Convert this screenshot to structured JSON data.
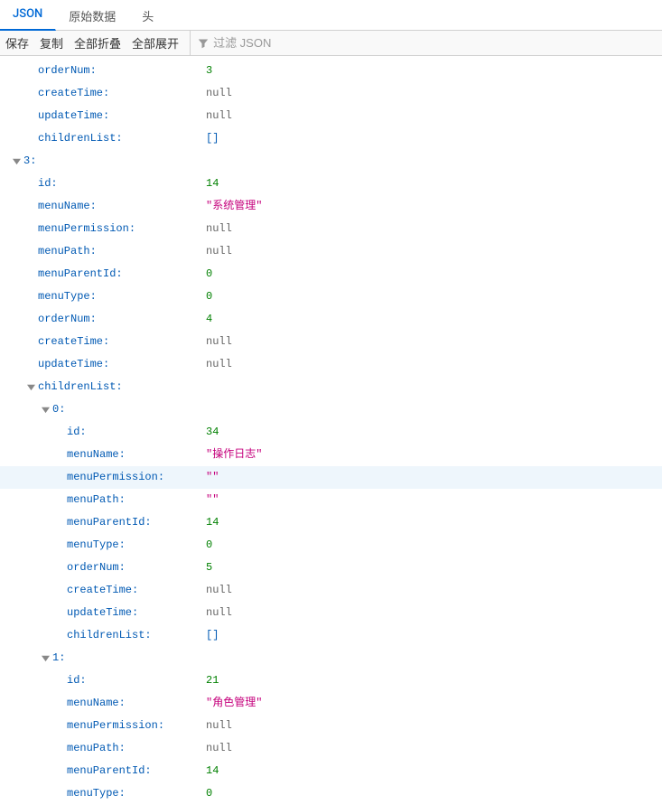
{
  "tabs": {
    "json": "JSON",
    "raw": "原始数据",
    "headers": "头"
  },
  "toolbar": {
    "save": "保存",
    "copy": "复制",
    "collapseAll": "全部折叠",
    "expandAll": "全部展开",
    "filterPlaceholder": "过滤 JSON"
  },
  "tree": {
    "partialTop": {
      "orderNum": {
        "key": "orderNum",
        "value": "3",
        "type": "num"
      },
      "createTime": {
        "key": "createTime",
        "value": "null",
        "type": "null"
      },
      "updateTime": {
        "key": "updateTime",
        "value": "null",
        "type": "null"
      },
      "childrenList": {
        "key": "childrenList",
        "value": "[]",
        "type": "bracket"
      }
    },
    "node3": {
      "index": "3",
      "id": {
        "key": "id",
        "value": "14",
        "type": "num"
      },
      "menuName": {
        "key": "menuName",
        "value": "\"系统管理\"",
        "type": "str"
      },
      "menuPermission": {
        "key": "menuPermission",
        "value": "null",
        "type": "null"
      },
      "menuPath": {
        "key": "menuPath",
        "value": "null",
        "type": "null"
      },
      "menuParentId": {
        "key": "menuParentId",
        "value": "0",
        "type": "num"
      },
      "menuType": {
        "key": "menuType",
        "value": "0",
        "type": "num"
      },
      "orderNum": {
        "key": "orderNum",
        "value": "4",
        "type": "num"
      },
      "createTime": {
        "key": "createTime",
        "value": "null",
        "type": "null"
      },
      "updateTime": {
        "key": "updateTime",
        "value": "null",
        "type": "null"
      },
      "childrenListKey": "childrenList",
      "child0": {
        "index": "0",
        "id": {
          "key": "id",
          "value": "34",
          "type": "num"
        },
        "menuName": {
          "key": "menuName",
          "value": "\"操作日志\"",
          "type": "str"
        },
        "menuPermission": {
          "key": "menuPermission",
          "value": "\"\"",
          "type": "str"
        },
        "menuPath": {
          "key": "menuPath",
          "value": "\"\"",
          "type": "str"
        },
        "menuParentId": {
          "key": "menuParentId",
          "value": "14",
          "type": "num"
        },
        "menuType": {
          "key": "menuType",
          "value": "0",
          "type": "num"
        },
        "orderNum": {
          "key": "orderNum",
          "value": "5",
          "type": "num"
        },
        "createTime": {
          "key": "createTime",
          "value": "null",
          "type": "null"
        },
        "updateTime": {
          "key": "updateTime",
          "value": "null",
          "type": "null"
        },
        "childrenList": {
          "key": "childrenList",
          "value": "[]",
          "type": "bracket"
        }
      },
      "child1": {
        "index": "1",
        "id": {
          "key": "id",
          "value": "21",
          "type": "num"
        },
        "menuName": {
          "key": "menuName",
          "value": "\"角色管理\"",
          "type": "str"
        },
        "menuPermission": {
          "key": "menuPermission",
          "value": "null",
          "type": "null"
        },
        "menuPath": {
          "key": "menuPath",
          "value": "null",
          "type": "null"
        },
        "menuParentId": {
          "key": "menuParentId",
          "value": "14",
          "type": "num"
        },
        "menuType": {
          "key": "menuType",
          "value": "0",
          "type": "num"
        }
      }
    }
  }
}
